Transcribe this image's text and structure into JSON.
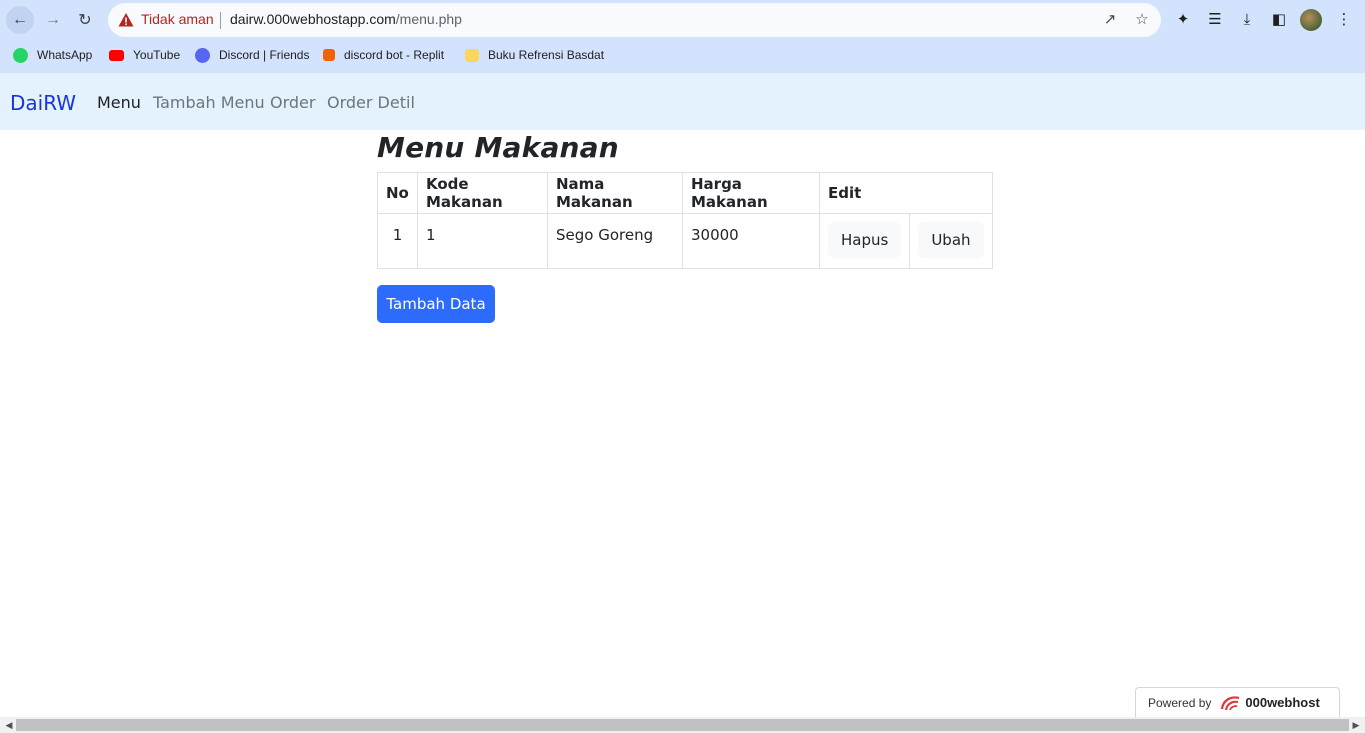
{
  "browser": {
    "security_label": "Tidak aman",
    "url_domain": "dairw.000webhostapp.com",
    "url_path": "/menu.php",
    "icons": [
      "back-icon",
      "forward-icon",
      "reload-icon",
      "warning-icon",
      "share-icon",
      "star-icon",
      "extensions-icon",
      "reading-list-icon",
      "download-icon",
      "sidepanel-icon",
      "profile-avatar",
      "more-icon"
    ],
    "bookmarks": [
      {
        "label": "WhatsApp",
        "icon": "whatsapp-icon",
        "color": "#25d366"
      },
      {
        "label": "YouTube",
        "icon": "youtube-icon",
        "color": "#ff0000"
      },
      {
        "label": "Discord | Friends",
        "icon": "discord-icon",
        "color": "#5865f2"
      },
      {
        "label": "discord bot - Replit",
        "icon": "replit-icon",
        "color": "#f26207"
      },
      {
        "label": "Buku Refrensi Basdat",
        "icon": "folder-icon",
        "color": "#f9d65c"
      }
    ]
  },
  "navbar": {
    "brand": "DaiRW",
    "links": [
      "Menu",
      "Tambah Menu",
      "Order",
      "Order Detil"
    ],
    "active_index": 0,
    "brand_color": "#1a33e0",
    "background": "#e3f2fd"
  },
  "main": {
    "title": "Menu Makanan",
    "table": {
      "headers": [
        "No",
        "Kode Makanan",
        "Nama Makanan",
        "Harga Makanan",
        "Edit"
      ],
      "rows": [
        {
          "no": "1",
          "kode": "1",
          "nama": "Sego Goreng",
          "harga": "30000",
          "hapus_label": "Hapus",
          "ubah_label": "Ubah"
        }
      ]
    },
    "add_button": "Tambah Data",
    "add_button_color": "#2c6bfb"
  },
  "footer_badge": {
    "prefix": "Powered by",
    "brand": "000webhost"
  }
}
